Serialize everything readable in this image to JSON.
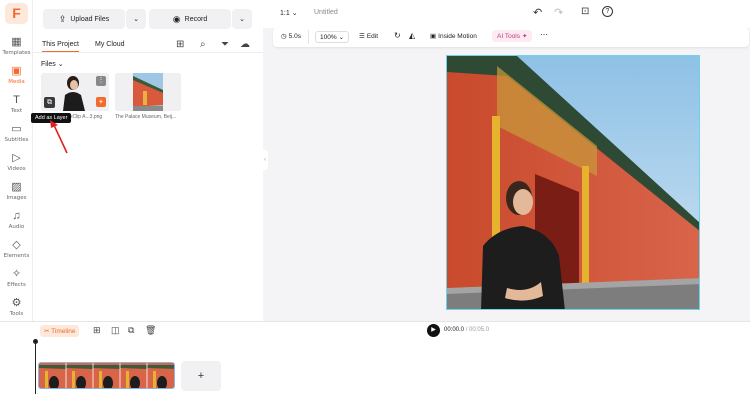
{
  "app": {
    "logo": "F",
    "title": "Untitled",
    "ratio": "1:1"
  },
  "rail": [
    {
      "label": "Templates",
      "icon": "▦"
    },
    {
      "label": "Media",
      "icon": "▣"
    },
    {
      "label": "Text",
      "icon": "T"
    },
    {
      "label": "Subtitles",
      "icon": "▭"
    },
    {
      "label": "Videos",
      "icon": "▷"
    },
    {
      "label": "Images",
      "icon": "▨"
    },
    {
      "label": "Audio",
      "icon": "♫"
    },
    {
      "label": "Elements",
      "icon": "◇"
    },
    {
      "label": "Effects",
      "icon": "✧"
    },
    {
      "label": "Tools",
      "icon": "⚙"
    }
  ],
  "panel": {
    "upload": "Upload Files",
    "record": "Record",
    "tab_project": "This Project",
    "tab_cloud": "My Cloud",
    "files_label": "Files",
    "files": [
      {
        "name": "FlexClip A...3.png"
      },
      {
        "name": "The Palace Museum, Beij..."
      }
    ],
    "tooltip": "Add as Layer"
  },
  "toolbar": {
    "duration": "5.0s",
    "zoom": "100%",
    "edit": "Edit",
    "inside_motion": "Inside Motion",
    "ai_tools": "AI Tools"
  },
  "timeline": {
    "label": "Timeline",
    "time": "00:00.0",
    "total": "00:05.0",
    "add": "+"
  },
  "colors": {
    "accent": "#f26a2e",
    "selection": "#6dd3e6"
  }
}
